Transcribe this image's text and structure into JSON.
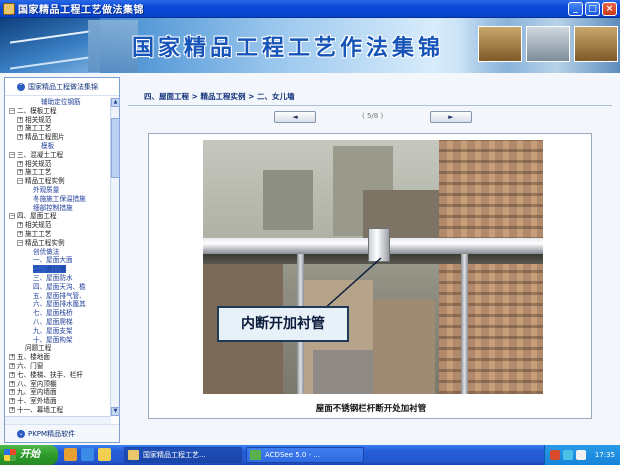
{
  "window": {
    "title": "国家精品工程工艺做法集锦",
    "buttons": [
      "_",
      "□",
      "×"
    ]
  },
  "banner": {
    "title": "国家精品工程工艺作法集锦"
  },
  "sidebar": {
    "header": "国家精品工程做法集锦",
    "footer": "PKPM精品软件",
    "rows": [
      {
        "label": "辅助定位钢筋",
        "indent": 4,
        "exp": ""
      },
      {
        "label": "二、模板工程",
        "indent": 0,
        "exp": "−"
      },
      {
        "label": "相关规范",
        "indent": 1,
        "exp": "+"
      },
      {
        "label": "施工工艺",
        "indent": 1,
        "exp": "+"
      },
      {
        "label": "精品工程图片",
        "indent": 1,
        "exp": "+"
      },
      {
        "label": "模板",
        "indent": 4,
        "exp": ""
      },
      {
        "label": "三、混凝土工程",
        "indent": 0,
        "exp": "−"
      },
      {
        "label": "相关规范",
        "indent": 1,
        "exp": "+"
      },
      {
        "label": "施工工艺",
        "indent": 1,
        "exp": "+"
      },
      {
        "label": "精品工程实例",
        "indent": 1,
        "exp": "−"
      },
      {
        "label": "外观质量",
        "indent": 3,
        "exp": ""
      },
      {
        "label": "冬施施工保温措施",
        "indent": 3,
        "exp": ""
      },
      {
        "label": "细部控制措施",
        "indent": 3,
        "exp": ""
      },
      {
        "label": "四、屋面工程",
        "indent": 0,
        "exp": "−"
      },
      {
        "label": "相关规范",
        "indent": 1,
        "exp": "+"
      },
      {
        "label": "施工工艺",
        "indent": 1,
        "exp": "+"
      },
      {
        "label": "精品工程实例",
        "indent": 1,
        "exp": "−"
      },
      {
        "label": "创优做法",
        "indent": 3,
        "exp": ""
      },
      {
        "label": "一、屋面大面",
        "indent": 3,
        "exp": ""
      },
      {
        "label": "二、女儿墙",
        "indent": 3,
        "exp": "",
        "selected": true
      },
      {
        "label": "三、屋面防水",
        "indent": 3,
        "exp": ""
      },
      {
        "label": "四、屋面天沟、檐",
        "indent": 3,
        "exp": ""
      },
      {
        "label": "五、屋面排气管、",
        "indent": 3,
        "exp": ""
      },
      {
        "label": "六、屋面排水篦其",
        "indent": 3,
        "exp": ""
      },
      {
        "label": "七、屋面栈桥",
        "indent": 3,
        "exp": ""
      },
      {
        "label": "八、屋面爬梯",
        "indent": 3,
        "exp": ""
      },
      {
        "label": "九、屋面支架",
        "indent": 3,
        "exp": ""
      },
      {
        "label": "十、屋面构架",
        "indent": 3,
        "exp": ""
      },
      {
        "label": "问题工程",
        "indent": 2,
        "exp": ""
      },
      {
        "label": "五、楼地面",
        "indent": 0,
        "exp": "+"
      },
      {
        "label": "六、门窗",
        "indent": 0,
        "exp": "+"
      },
      {
        "label": "七、楼梯、扶手、栏杆",
        "indent": 0,
        "exp": "+"
      },
      {
        "label": "八、室内顶棚",
        "indent": 0,
        "exp": "+"
      },
      {
        "label": "九、室内墙面",
        "indent": 0,
        "exp": "+"
      },
      {
        "label": "十、室外墙面",
        "indent": 0,
        "exp": "+"
      },
      {
        "label": "十一、幕墙工程",
        "indent": 0,
        "exp": "+"
      }
    ]
  },
  "main": {
    "breadcrumb": "四、屋面工程 > 精品工程实例 > 二、女儿墙",
    "prev_label": "◄",
    "next_label": "►",
    "page_info": "( 5/8 )",
    "callout": "内断开加衬管",
    "caption": "屋面不锈钢栏杆断开处加衬管"
  },
  "taskbar": {
    "start": "开始",
    "tasks": [
      "国家精品工程工艺...",
      "ACDSee 5.0 - ..."
    ],
    "clock": "17:35"
  }
}
